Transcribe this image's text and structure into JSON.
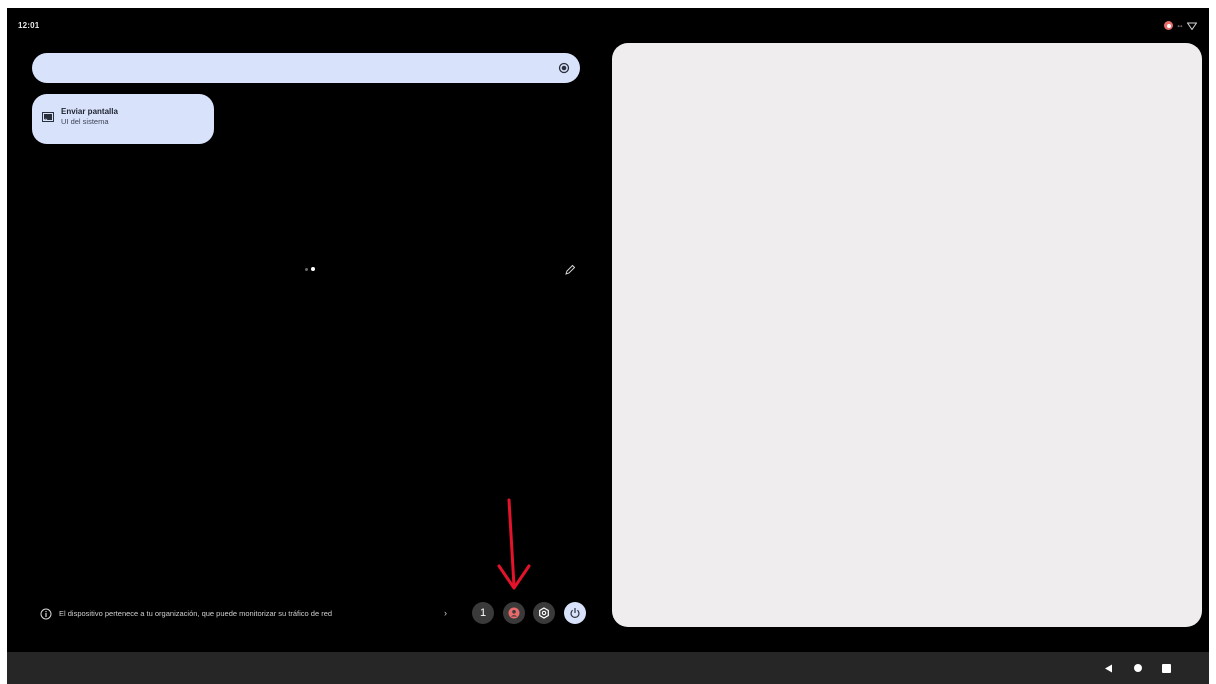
{
  "status_bar": {
    "time": "12:01",
    "icons": [
      "screen-record-icon",
      "data-sync-icon",
      "wifi-icon"
    ]
  },
  "quick_settings": {
    "brightness": {
      "icon": "brightness-icon",
      "level": 1.0
    },
    "tiles": [
      {
        "label": "Enviar pantalla",
        "sublabel": "UI del sistema",
        "icon": "cast-icon",
        "active": true
      }
    ],
    "pages": 2,
    "current_page": 2,
    "edit_icon": "pencil-icon"
  },
  "footer": {
    "info_icon": "info-icon",
    "message": "El dispositivo pertenece a tu organización, que puede monitorizar su tráfico de red",
    "chevron_icon": "chevron-right-icon",
    "notification_count": "1",
    "buttons": [
      "user-switcher-icon",
      "settings-icon",
      "power-icon"
    ]
  },
  "annotation": {
    "type": "arrow",
    "color": "#e4122a",
    "points_to": "user-switcher-button"
  },
  "colors": {
    "background": "#000000",
    "tile_bg": "#d9e2fb",
    "panel_bg": "#efeded",
    "navbar_bg": "#262626",
    "record_red": "#e86a6a"
  },
  "navigation_bar": {
    "buttons": [
      "back-icon",
      "home-icon",
      "recents-icon"
    ]
  }
}
